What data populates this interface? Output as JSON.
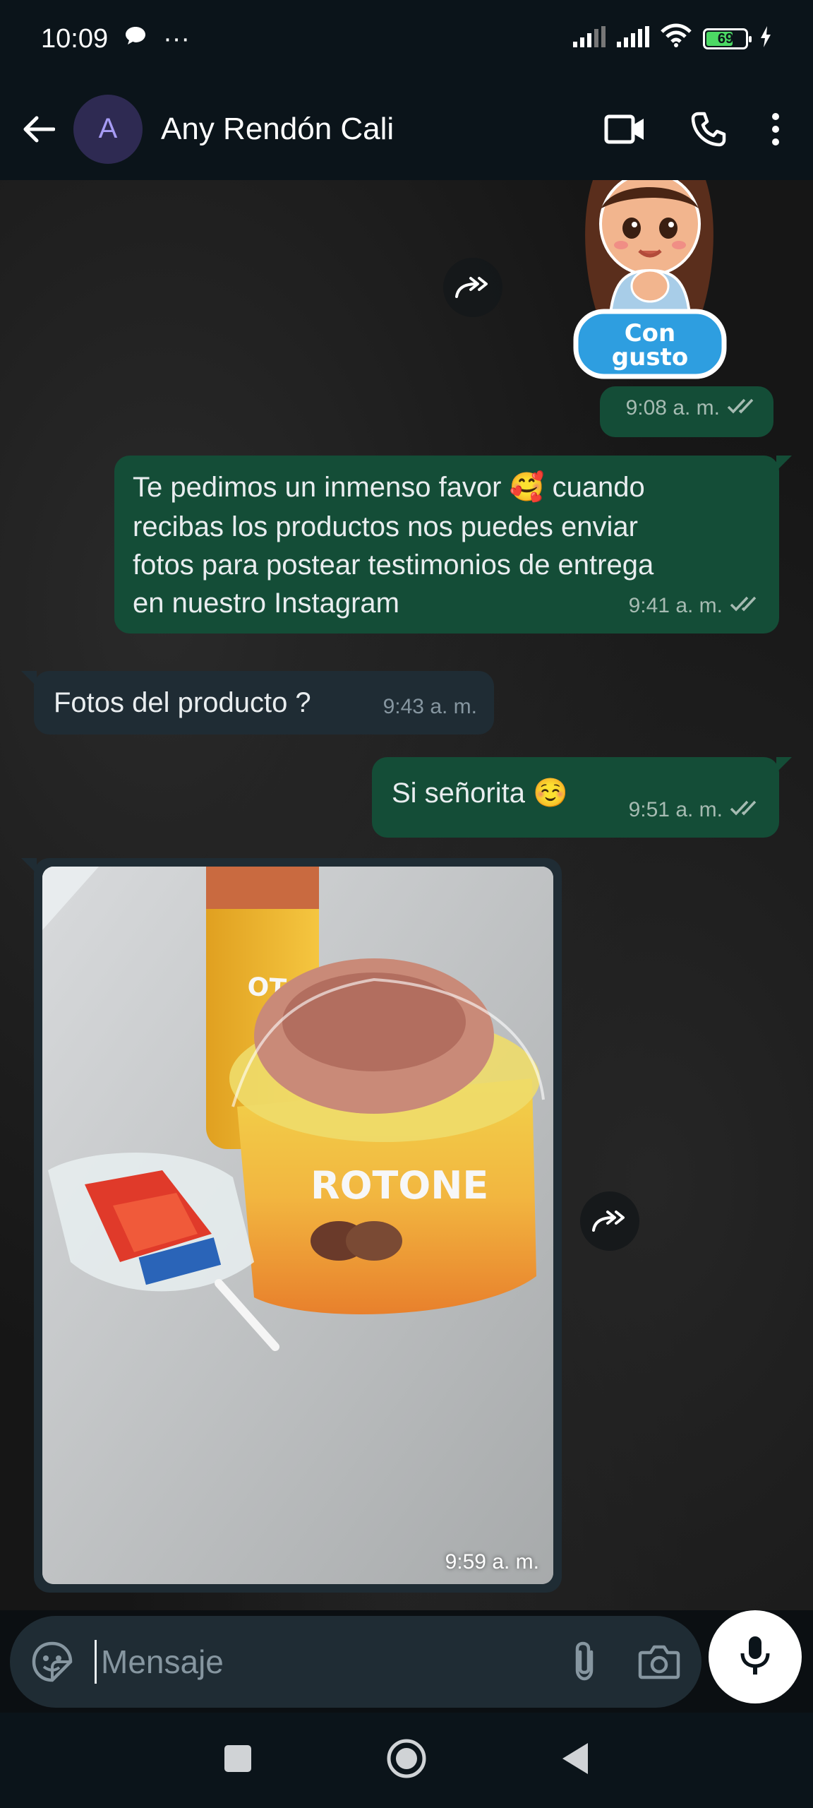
{
  "status_bar": {
    "time": "10:09",
    "dots": "···",
    "battery_level": "69",
    "battery_fraction": 0.69,
    "icons": [
      "chat-bubble-icon",
      "signal-icon",
      "signal-icon",
      "wifi-icon",
      "battery-icon",
      "charging-icon"
    ]
  },
  "header": {
    "avatar_letter": "A",
    "contact_name": "Any Rendón Cali",
    "icons": [
      "back-arrow-icon",
      "video-call-icon",
      "phone-icon",
      "more-vert-icon"
    ]
  },
  "messages": [
    {
      "type": "sticker",
      "direction": "outgoing",
      "sticker_text_1": "Con",
      "sticker_text_2": "gusto",
      "time": "9:08 a. m."
    },
    {
      "type": "text",
      "direction": "outgoing",
      "text_before_emoji": "Te pedimos un inmenso favor",
      "emoji": "🥰",
      "text_after_emoji": "cuando",
      "line_2": "recibas los productos nos puedes enviar",
      "line_3": "fotos para postear  testimonios de entrega",
      "line_4": "en nuestro Instagram",
      "time": "9:41 a. m."
    },
    {
      "type": "text",
      "direction": "incoming",
      "text": "Fotos del producto ?",
      "time": "9:43 a. m."
    },
    {
      "type": "text",
      "direction": "outgoing",
      "text": "Si señorita",
      "emoji": "☺️",
      "time": "9:51 a. m."
    },
    {
      "type": "image",
      "direction": "incoming",
      "product_label": "ROTONE",
      "time": "9:59 a. m."
    }
  ],
  "composer": {
    "placeholder": "Mensaje",
    "icons": [
      "sticker-icon",
      "attach-icon",
      "camera-icon",
      "mic-icon"
    ]
  },
  "nav_bar": {
    "icons": [
      "recents-square-icon",
      "home-circle-icon",
      "back-triangle-icon"
    ]
  },
  "colors": {
    "outgoing_bubble": "#144d37",
    "incoming_bubble": "#1f2c34",
    "header_bg": "#0b141a",
    "avatar_bg": "#2e2a52",
    "avatar_text": "#a79cf5"
  }
}
